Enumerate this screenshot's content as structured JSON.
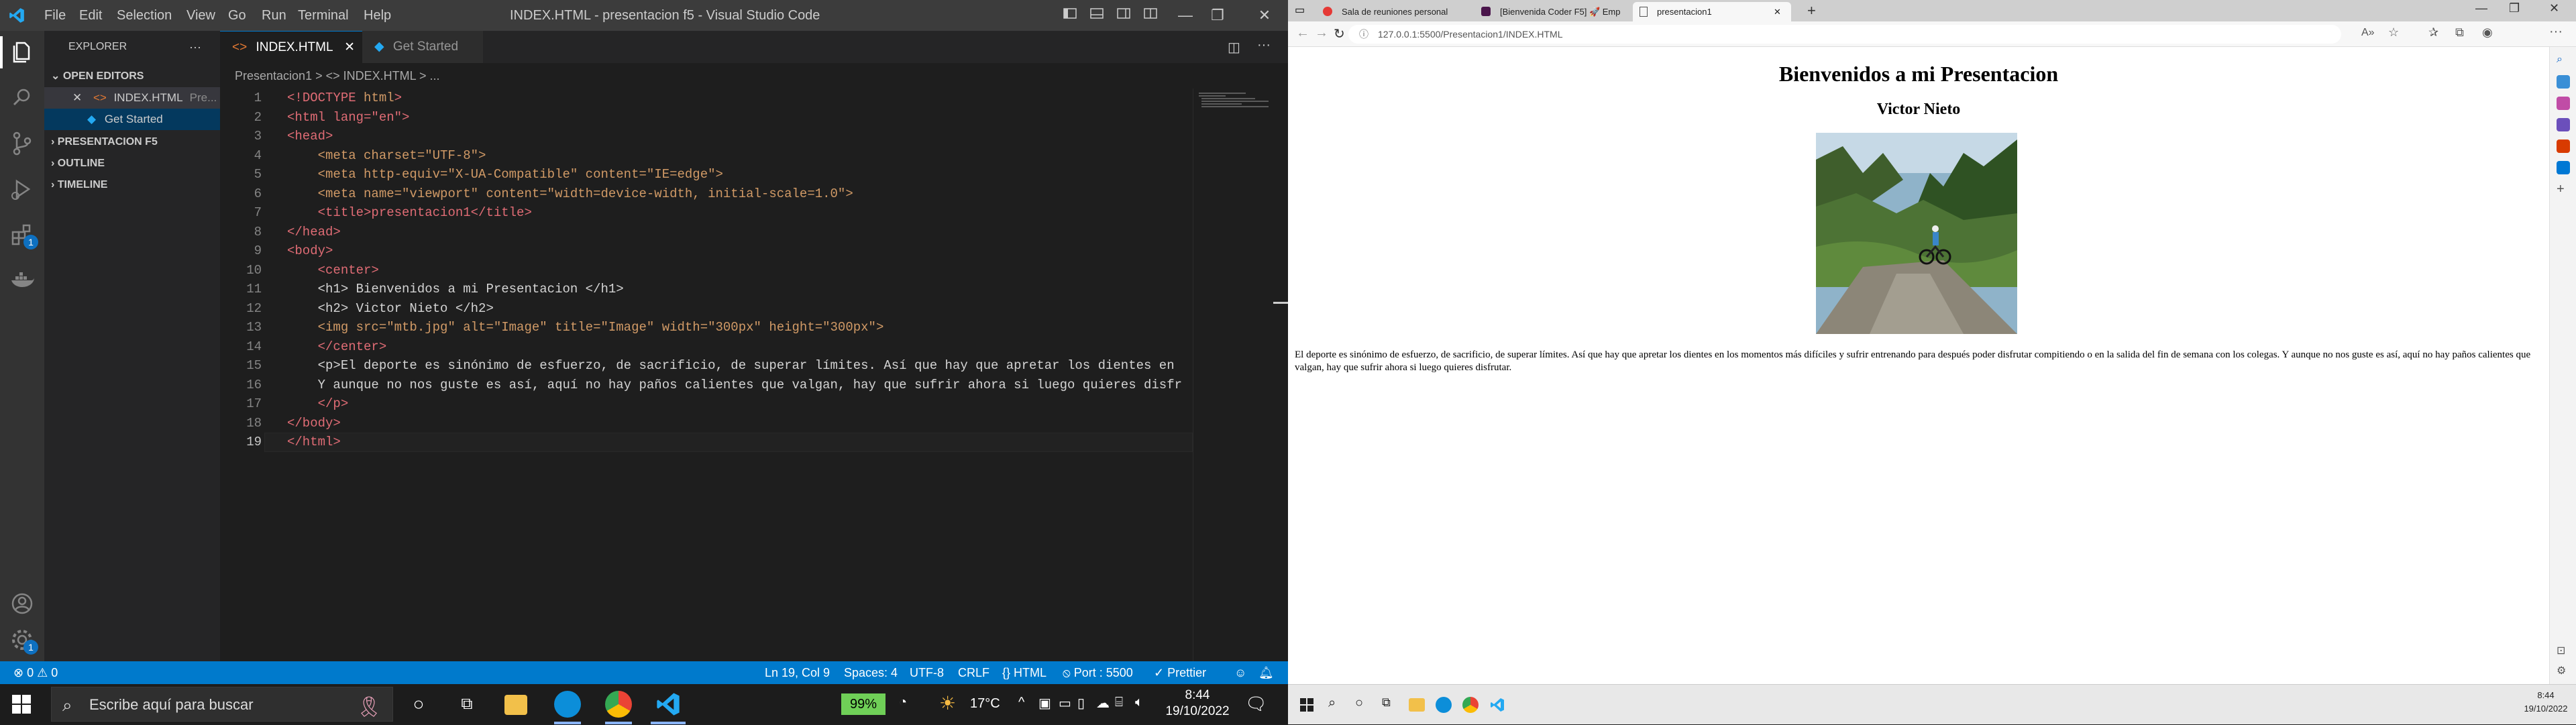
{
  "vscode": {
    "menu": [
      "File",
      "Edit",
      "Selection",
      "View",
      "Go",
      "Run",
      "Terminal",
      "Help"
    ],
    "window_title": "INDEX.HTML - presentacion f5 - Visual Studio Code",
    "explorer_label": "EXPLORER",
    "explorer_more": "···",
    "open_editors_label": "OPEN EDITORS",
    "open_editors": [
      {
        "close": "✕",
        "name": "INDEX.HTML",
        "path": "Pre..."
      },
      {
        "name": "Get Started"
      }
    ],
    "workspace_label": "PRESENTACION F5",
    "outline_label": "OUTLINE",
    "timeline_label": "TIMELINE",
    "activity_badges": {
      "extensions": "1",
      "manage": "1"
    },
    "tabs": [
      {
        "label": "INDEX.HTML",
        "close": "✕"
      },
      {
        "label": "Get Started"
      }
    ],
    "breadcrumb": "Presentacion1 > <> INDEX.HTML > ...",
    "line_numbers": [
      "1",
      "2",
      "3",
      "4",
      "5",
      "6",
      "7",
      "8",
      "9",
      "10",
      "11",
      "12",
      "13",
      "14",
      "15",
      "16",
      "17",
      "18",
      "19"
    ],
    "code": {
      "l1a": "<!",
      "l1b": "DOCTYPE",
      "l1c": " html",
      "l2": "<html lang=\"en\">",
      "l3": "<head>",
      "l4": "    <meta charset=\"UTF-8\">",
      "l5": "    <meta http-equiv=\"X-UA-Compatible\" content=\"IE=edge\">",
      "l6": "    <meta name=\"viewport\" content=\"width=device-width, initial-scale=1.0\">",
      "l7": "    <title>presentacion1</title>",
      "l8": "</head>",
      "l9": "<body>",
      "l10": "    <center>",
      "l11": "    <h1> Bienvenidos a mi Presentacion </h1>",
      "l12": "    <h2> Victor Nieto </h2>",
      "l13": "    <img src=\"mtb.jpg\" alt=\"Image\" title=\"Image\" width=\"300px\" height=\"300px\">",
      "l14": "    </center>",
      "l15": "    <p>El deporte es sinónimo de esfuerzo, de sacrificio, de superar límites. Así que hay que apretar los dientes en",
      "l16": "    Y aunque no nos guste es así, aquí no hay paños calientes que valgan, hay que sufrir ahora si luego quieres disfr",
      "l17": "    </p>",
      "l18": "</body>",
      "l19": "</html>"
    },
    "status": {
      "errors": "⊗ 0 ⚠ 0",
      "position": "Ln 19, Col 9",
      "spaces": "Spaces: 4",
      "encoding": "UTF-8",
      "eol": "CRLF",
      "language": "{} HTML",
      "port": "⦸ Port : 5500",
      "prettier": "✓ Prettier"
    }
  },
  "browser": {
    "tabs": [
      {
        "label": "Sala de reuniones personal"
      },
      {
        "label": "[Bienvenida Coder F5] 🚀 Emp"
      },
      {
        "label": "presentacion1"
      }
    ],
    "url": "127.0.0.1:5500/Presentacion1/INDEX.HTML",
    "page": {
      "h1": "Bienvenidos a mi Presentacion",
      "h2": "Victor Nieto",
      "paragraph": "El deporte es sinónimo de esfuerzo, de sacrificio, de superar límites. Así que hay que apretar los dientes en los momentos más difíciles y sufrir entrenando para después poder disfrutar compitiendo o en la salida del fin de semana con los colegas. Y aunque no nos guste es así, aquí no hay paños calientes que valgan, hay que sufrir ahora si luego quieres disfrutar."
    }
  },
  "taskbar_left": {
    "search_placeholder": "Escribe aquí para buscar",
    "battery": "99%",
    "temperature": "17°C",
    "time": "8:44",
    "date": "19/10/2022"
  },
  "taskbar_right": {
    "time": "8:44",
    "date": "19/10/2022"
  }
}
